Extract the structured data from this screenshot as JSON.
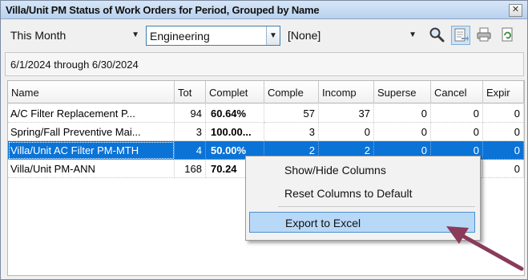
{
  "window": {
    "title": "Villa/Unit PM Status of Work Orders for Period, Grouped by Name",
    "close_glyph": "✕"
  },
  "toolbar": {
    "period": "This Month",
    "department": "Engineering",
    "filter": "[None]",
    "icons": [
      "search-icon",
      "export-icon",
      "print-icon",
      "refresh-icon"
    ]
  },
  "date_range": "6/1/2024 through 6/30/2024",
  "grid": {
    "columns": [
      "Name",
      "Tot",
      "Complet",
      "Comple",
      "Incomp",
      "Superse",
      "Cancel",
      "Expir"
    ],
    "rows": [
      [
        "A/C Filter Replacement P...",
        "94",
        "60.64%",
        "57",
        "37",
        "0",
        "0",
        "0"
      ],
      [
        "Spring/Fall Preventive Mai...",
        "3",
        "100.00...",
        "3",
        "0",
        "0",
        "0",
        "0"
      ],
      [
        "Villa/Unit AC Filter PM-MTH",
        "4",
        "50.00%",
        "2",
        "2",
        "0",
        "0",
        "0"
      ],
      [
        "Villa/Unit PM-ANN",
        "168",
        "70.24",
        "",
        "",
        "",
        "0",
        "0"
      ]
    ],
    "selected_row": 2
  },
  "context_menu": {
    "items": [
      "Show/Hide Columns",
      "Reset Columns to Default",
      "Export to Excel"
    ],
    "highlighted": 2
  },
  "colors": {
    "selection": "#0b73d6",
    "menu_hover": "#b8d8f7",
    "arrow": "#8b3a5a"
  }
}
